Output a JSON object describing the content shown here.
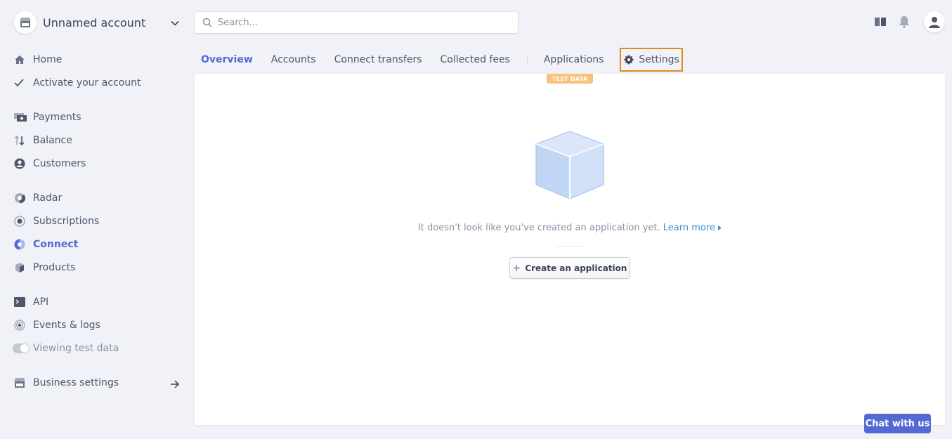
{
  "account": {
    "name": "Unnamed account"
  },
  "search": {
    "placeholder": "Search..."
  },
  "sidebar": {
    "items": [
      {
        "label": "Home"
      },
      {
        "label": "Activate your account"
      },
      {
        "label": "Payments"
      },
      {
        "label": "Balance"
      },
      {
        "label": "Customers"
      },
      {
        "label": "Radar"
      },
      {
        "label": "Subscriptions"
      },
      {
        "label": "Connect"
      },
      {
        "label": "Products"
      },
      {
        "label": "API"
      },
      {
        "label": "Events & logs"
      },
      {
        "label": "Viewing test data"
      },
      {
        "label": "Business settings"
      }
    ],
    "active": "Connect"
  },
  "tabs": [
    {
      "label": "Overview"
    },
    {
      "label": "Accounts"
    },
    {
      "label": "Connect transfers"
    },
    {
      "label": "Collected fees"
    },
    {
      "label": "Applications"
    },
    {
      "label": "Settings"
    }
  ],
  "panel": {
    "badge": "TEST DATA",
    "message": "It doesn't look like you've created an application yet.",
    "learn_more": "Learn more",
    "create_button": "Create an application"
  },
  "chat": {
    "label": "Chat with us"
  },
  "colors": {
    "accent": "#5469d4",
    "highlight": "#e08a1e",
    "badge": "#f8c27e",
    "link": "#3d8fd0"
  }
}
